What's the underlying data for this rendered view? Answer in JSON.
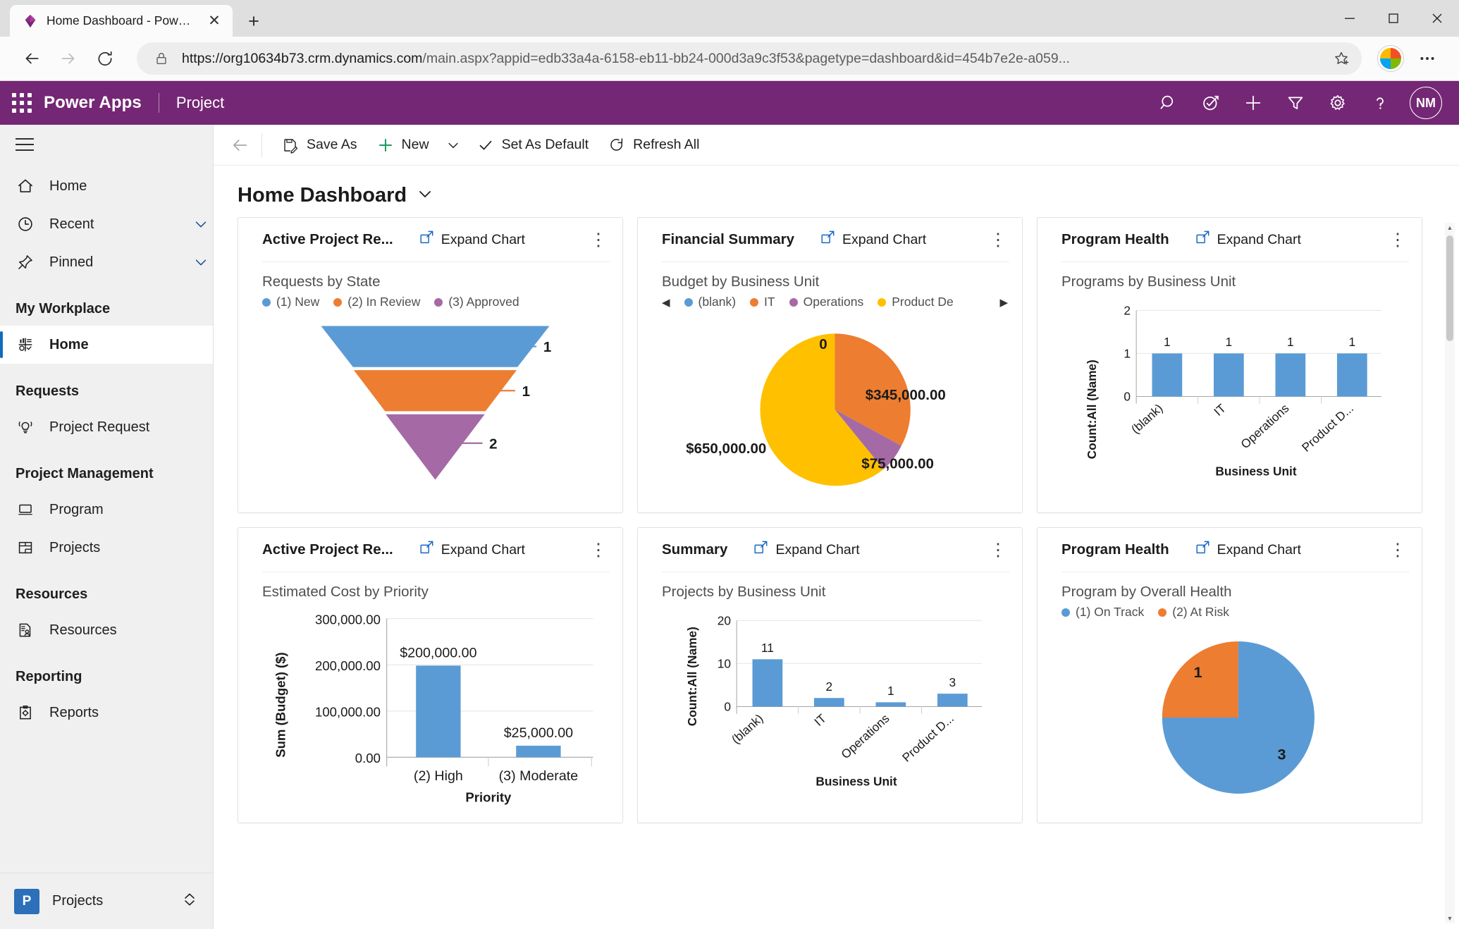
{
  "browser": {
    "tab_title": "Home Dashboard - Power Apps",
    "tab_favicon": "powerapps-icon",
    "close_tab_label": "✕",
    "new_tab_label": "+",
    "window_minimize": "—",
    "window_maximize": "▢",
    "window_close": "✕",
    "back_label": "←",
    "forward_label": "→",
    "reload_label": "⟳",
    "url_host": "https://org10634b73.crm.dynamics.com",
    "url_path": "/main.aspx?appid=edb33a4a-6158-eb11-bb24-000d3a9c3f53&pagetype=dashboard&id=454b7e2e-a059...",
    "favorites_label": "☆",
    "more_label": "⋯"
  },
  "topbar": {
    "waffle": "app-launcher-icon",
    "brand": "Power Apps",
    "app_name": "Project",
    "icons": [
      {
        "name": "search-icon",
        "glyph": "⌕"
      },
      {
        "name": "assistant-icon",
        "glyph": "◉"
      },
      {
        "name": "quick-create-icon",
        "glyph": "+"
      },
      {
        "name": "filter-icon",
        "glyph": "▽"
      },
      {
        "name": "settings-gear-icon",
        "glyph": "⚙"
      },
      {
        "name": "help-icon",
        "glyph": "?"
      }
    ],
    "avatar_initials": "NM",
    "accent_color": "#742774"
  },
  "sidebar": {
    "quick": [
      {
        "label": "Home",
        "icon": "home-icon",
        "chevron": false
      },
      {
        "label": "Recent",
        "icon": "clock-icon",
        "chevron": true
      },
      {
        "label": "Pinned",
        "icon": "pin-icon",
        "chevron": true
      }
    ],
    "groups": [
      {
        "title": "My Workplace",
        "items": [
          {
            "label": "Home",
            "icon": "dashboard-icon",
            "active": true
          }
        ]
      },
      {
        "title": "Requests",
        "items": [
          {
            "label": "Project Request",
            "icon": "idea-icon",
            "active": false
          }
        ]
      },
      {
        "title": "Project Management",
        "items": [
          {
            "label": "Program",
            "icon": "program-icon",
            "active": false
          },
          {
            "label": "Projects",
            "icon": "projects-icon",
            "active": false
          }
        ]
      },
      {
        "title": "Resources",
        "items": [
          {
            "label": "Resources",
            "icon": "resources-icon",
            "active": false
          }
        ]
      },
      {
        "title": "Reporting",
        "items": [
          {
            "label": "Reports",
            "icon": "reports-icon",
            "active": false
          }
        ]
      }
    ],
    "footer": {
      "badge": "P",
      "label": "Projects",
      "switcher_icon": "area-switcher-icon"
    }
  },
  "commandbar": {
    "back": "←",
    "buttons": [
      {
        "label": "Save As",
        "icon": "save-as-icon",
        "caret": false
      },
      {
        "label": "New",
        "icon": "plus-icon",
        "caret": true
      },
      {
        "label": "Set As Default",
        "icon": "check-icon",
        "caret": false
      },
      {
        "label": "Refresh All",
        "icon": "refresh-icon",
        "caret": false
      }
    ]
  },
  "page": {
    "title": "Home Dashboard",
    "title_caret": "chevron-down-icon"
  },
  "card_common": {
    "expand_label": "Expand Chart",
    "expand_icon": "expand-chart-icon",
    "kebab": "⋮"
  },
  "colors": {
    "blue": "#5B9BD5",
    "orange": "#ED7D31",
    "purple": "#A569A5",
    "yellow": "#FFC000",
    "accent_purple": "#742774",
    "active_blue": "#0f6cbd"
  },
  "cards": [
    {
      "title": "Active Project Re...",
      "chart_index": 0
    },
    {
      "title": "Financial Summary",
      "chart_index": 1
    },
    {
      "title": "Program Health",
      "chart_index": 2
    },
    {
      "title": "Active Project Re...",
      "chart_index": 3
    },
    {
      "title": "Summary",
      "chart_index": 4
    },
    {
      "title": "Program Health",
      "chart_index": 5
    }
  ],
  "chart_data": [
    {
      "type": "funnel",
      "title": "Requests by State",
      "categories": [
        "(1) New",
        "(2) In Review",
        "(3) Approved"
      ],
      "values": [
        1,
        1,
        2
      ],
      "labels": [
        "1",
        "1",
        "2"
      ],
      "colors": [
        "#5B9BD5",
        "#ED7D31",
        "#A569A5"
      ],
      "legend": [
        "(1) New",
        "(2) In Review",
        "(3) Approved"
      ],
      "legend_position": "top",
      "xlabel": "",
      "ylabel": ""
    },
    {
      "type": "pie",
      "title": "Budget by Business Unit",
      "categories": [
        "(blank)",
        "IT",
        "Operations",
        "Product De"
      ],
      "values": [
        0,
        345000,
        75000,
        650000
      ],
      "labels": [
        "0",
        "$345,000.00",
        "$75,000.00",
        "$650,000.00"
      ],
      "colors": [
        "#5B9BD5",
        "#ED7D31",
        "#A569A5",
        "#FFC000"
      ],
      "legend": [
        "(blank)",
        "IT",
        "Operations",
        "Product De"
      ],
      "legend_scroll_left": "◀",
      "legend_scroll_right": "▶",
      "legend_position": "top"
    },
    {
      "type": "bar",
      "title": "Programs by Business Unit",
      "categories": [
        "(blank)",
        "IT",
        "Operations",
        "Product D..."
      ],
      "values": [
        1,
        1,
        1,
        1
      ],
      "labels": [
        "1",
        "1",
        "1",
        "1"
      ],
      "ylabel": "Count:All (Name)",
      "xlabel": "Business Unit",
      "yticks": [
        "0",
        "1",
        "2"
      ],
      "ylim": [
        0,
        2
      ],
      "color": "#5B9BD5",
      "grid": true
    },
    {
      "type": "bar",
      "title": "Estimated Cost by Priority",
      "categories": [
        "(2) High",
        "(3) Moderate"
      ],
      "values": [
        200000,
        25000
      ],
      "labels": [
        "$200,000.00",
        "$25,000.00"
      ],
      "ylabel": "Sum (Budget) ($)",
      "xlabel": "Priority",
      "yticks": [
        "0.00",
        "100,000.00",
        "200,000.00",
        "300,000.00"
      ],
      "ylim": [
        0,
        300000
      ],
      "color": "#5B9BD5",
      "grid": true
    },
    {
      "type": "bar",
      "title": "Projects by Business Unit",
      "categories": [
        "(blank)",
        "IT",
        "Operations",
        "Product D..."
      ],
      "values": [
        11,
        2,
        1,
        3
      ],
      "labels": [
        "11",
        "2",
        "1",
        "3"
      ],
      "ylabel": "Count:All (Name)",
      "xlabel": "Business Unit",
      "yticks": [
        "0",
        "10",
        "20"
      ],
      "ylim": [
        0,
        20
      ],
      "color": "#5B9BD5",
      "grid": true
    },
    {
      "type": "pie",
      "title": "Program by Overall Health",
      "categories": [
        "(1) On Track",
        "(2) At Risk"
      ],
      "values": [
        3,
        1
      ],
      "labels": [
        "3",
        "1"
      ],
      "colors": [
        "#5B9BD5",
        "#ED7D31"
      ],
      "legend": [
        "(1) On Track",
        "(2) At Risk"
      ],
      "legend_position": "top"
    }
  ]
}
